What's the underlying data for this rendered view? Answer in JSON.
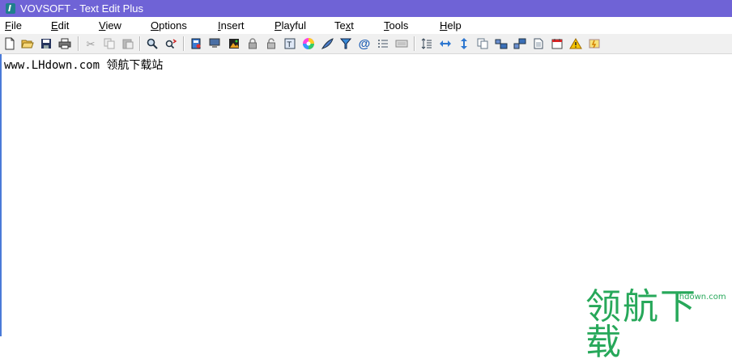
{
  "window": {
    "title": "VOVSOFT - Text Edit Plus"
  },
  "menu": [
    {
      "pre": "",
      "u": "F",
      "post": "ile"
    },
    {
      "pre": "",
      "u": "E",
      "post": "dit"
    },
    {
      "pre": "",
      "u": "V",
      "post": "iew"
    },
    {
      "pre": "",
      "u": "O",
      "post": "ptions"
    },
    {
      "pre": "",
      "u": "I",
      "post": "nsert"
    },
    {
      "pre": "",
      "u": "P",
      "post": "layful"
    },
    {
      "pre": "Te",
      "u": "x",
      "post": "t"
    },
    {
      "pre": "",
      "u": "T",
      "post": "ools"
    },
    {
      "pre": "",
      "u": "H",
      "post": "elp"
    }
  ],
  "toolbar_icons": [
    "new-file-icon",
    "open-folder-icon",
    "save-icon",
    "print-icon",
    "cut-icon",
    "copy-icon",
    "paste-icon",
    "find-icon",
    "replace-icon",
    "book-icon",
    "monitor-icon",
    "image-icon",
    "lock-icon",
    "unlock-icon",
    "text-box-icon",
    "color-wheel-icon",
    "feather-icon",
    "filter-icon",
    "at-sign-icon",
    "list-icon",
    "keyboard-icon",
    "line-spacing-icon",
    "left-right-arrows-icon",
    "up-down-arrows-icon",
    "duplicate-icon",
    "sort-ascending-icon",
    "sort-descending-icon",
    "document-icon",
    "calendar-icon",
    "warning-icon",
    "note-icon"
  ],
  "editor": {
    "content": "www.LHdown.com  领航下载站"
  },
  "watermark": {
    "text": "领航下载",
    "url": "lhdown.com"
  },
  "colors": {
    "titlebar": "#6f63d6",
    "watermark": "#27a85a"
  }
}
